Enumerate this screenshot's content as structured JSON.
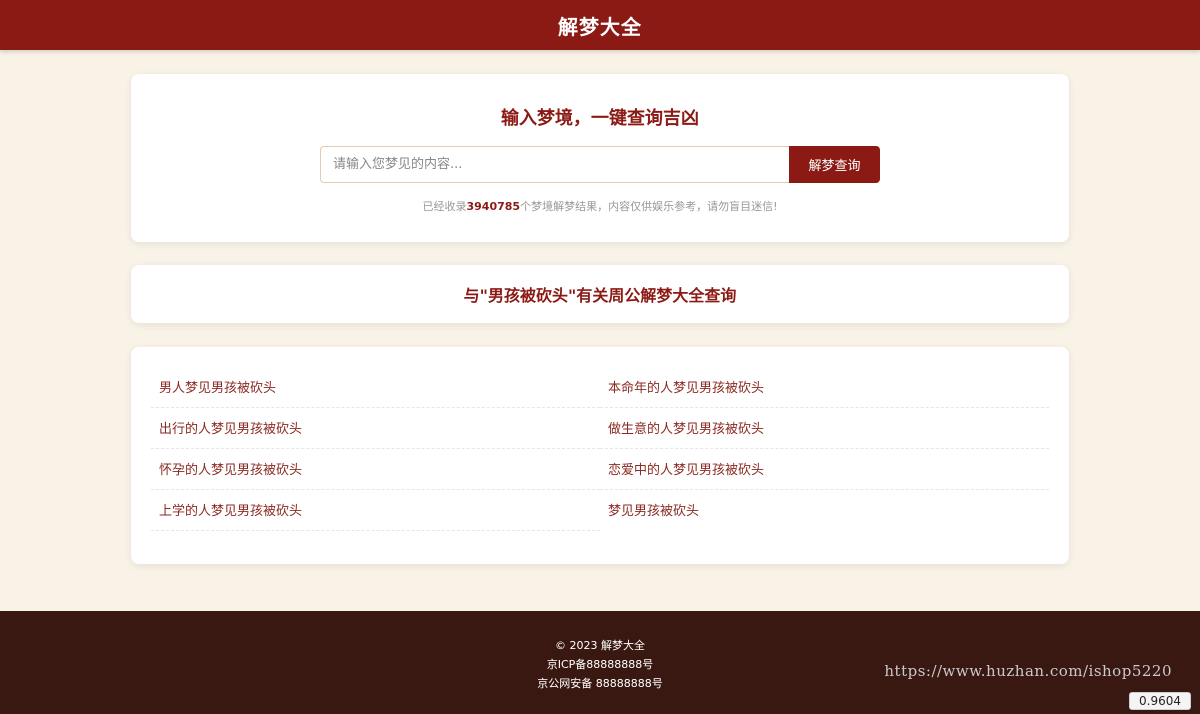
{
  "header": {
    "title": "解梦大全"
  },
  "search": {
    "heading": "输入梦境，一键查询吉凶",
    "placeholder": "请输入您梦见的内容...",
    "button_label": "解梦查询",
    "stats_prefix": "已经收录",
    "stats_count": "3940785",
    "stats_suffix": "个梦境解梦结果，内容仅供娱乐参考，请勿盲目迷信!"
  },
  "results": {
    "heading": "与\"男孩被砍头\"有关周公解梦大全查询",
    "items": [
      {
        "label": "男人梦见男孩被砍头"
      },
      {
        "label": "本命年的人梦见男孩被砍头"
      },
      {
        "label": "出行的人梦见男孩被砍头"
      },
      {
        "label": "做生意的人梦见男孩被砍头"
      },
      {
        "label": "怀孕的人梦见男孩被砍头"
      },
      {
        "label": "恋爱中的人梦见男孩被砍头"
      },
      {
        "label": "上学的人梦见男孩被砍头"
      },
      {
        "label": "梦见男孩被砍头"
      }
    ]
  },
  "footer": {
    "copyright": "© 2023 解梦大全",
    "icp": "京ICP备88888888号",
    "police": "京公网安备 88888888号"
  },
  "overlay": {
    "watermark": "https://www.huzhan.com/ishop5220",
    "badge": "0.9604"
  },
  "colors": {
    "brand": "#8b1a14",
    "background": "#f9f2e7",
    "footer": "#3a1812"
  }
}
